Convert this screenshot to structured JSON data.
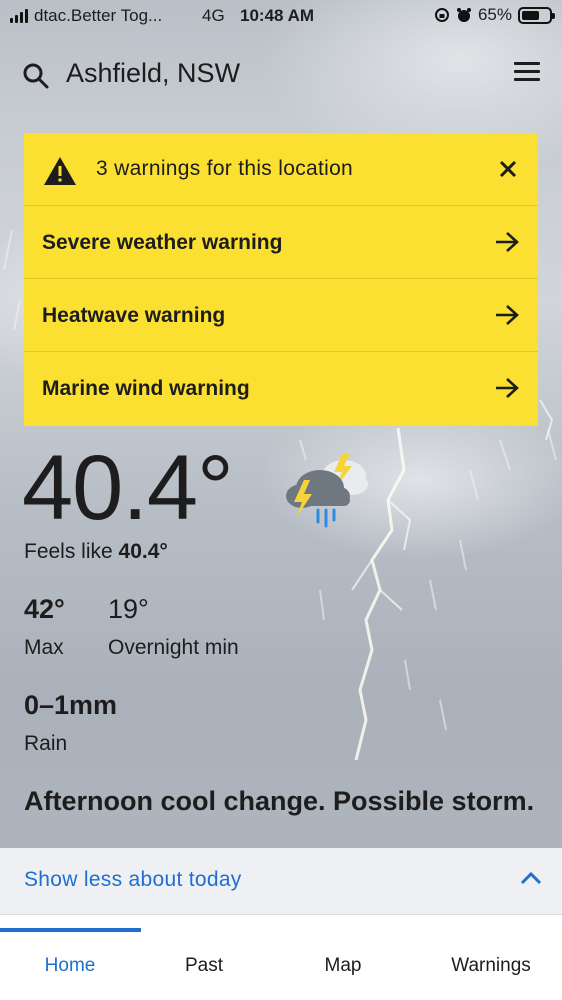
{
  "status_bar": {
    "carrier": "dtac.Better Tog...",
    "network": "4G",
    "time": "10:48 AM",
    "battery": "65%",
    "battery_level": 0.65
  },
  "header": {
    "location": "Ashfield, NSW",
    "search_icon": "search-icon",
    "menu_icon": "hamburger-menu-icon"
  },
  "warnings": {
    "title": "3 warnings for this location",
    "items": [
      {
        "label": "Severe weather warning"
      },
      {
        "label": "Heatwave warning"
      },
      {
        "label": "Marine wind warning"
      }
    ],
    "color": "#fbe031"
  },
  "current": {
    "temperature": "40.4°",
    "feels_like_label": "Feels like",
    "feels_like_value": "40.4°",
    "max_value": "42°",
    "max_label": "Max",
    "min_value": "19°",
    "min_label": "Overnight min",
    "rain_value": "0–1mm",
    "rain_label": "Rain",
    "summary": "Afternoon cool change. Possible storm.",
    "icon": "storm-cloud-icon"
  },
  "show_less": {
    "label": "Show less about today"
  },
  "nav": {
    "tabs": [
      {
        "label": "Home",
        "active": true
      },
      {
        "label": "Past",
        "active": false
      },
      {
        "label": "Map",
        "active": false
      },
      {
        "label": "Warnings",
        "active": false
      }
    ],
    "accent": "#1f6fcf"
  }
}
